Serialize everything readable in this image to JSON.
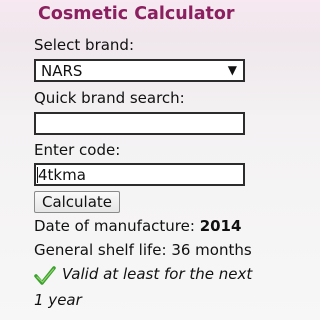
{
  "app": {
    "title": "Cosmetic Calculator"
  },
  "form": {
    "brand_label": "Select brand:",
    "brand_value": "NARS",
    "search_label": "Quick brand search:",
    "search_value": "",
    "code_label": "Enter code:",
    "code_value": "4tkma",
    "calculate_label": "Calculate"
  },
  "result": {
    "manufacture_label": "Date of manufacture:",
    "manufacture_value": "2014",
    "shelf_life_text": "General shelf life: 36 months",
    "valid_line1": "Valid at least for the next",
    "valid_line2": "1 year",
    "check_color": "#3aa02c"
  }
}
